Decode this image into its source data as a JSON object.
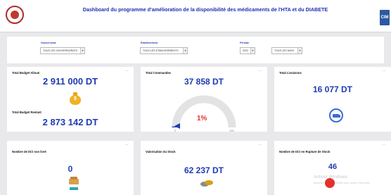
{
  "header": {
    "title": "Dashboard du programme d'amélioration de la disponibilité des médicaments de l'HTA et du DIABETE",
    "right_badge": "CIM"
  },
  "filters": {
    "governorate": {
      "label": "Gouvernorat",
      "value": "TOUS LES GOUVERNORATS"
    },
    "establishment": {
      "label": "Etablissement",
      "value": "TOUS LES ETABLISSEMENTS"
    },
    "period": {
      "label": "Période",
      "year": "2022",
      "month": "TOUS LES MOIS"
    }
  },
  "cards": {
    "budget": {
      "allocated_title": "Total Budget Alloué",
      "allocated_value": "2 911 000 DT",
      "remaining_title": "Total Budget Restant",
      "remaining_value": "2 873 142 DT"
    },
    "orders": {
      "title": "Total Commandes",
      "value": "37 858 DT",
      "gauge_percent_label": "1%",
      "gauge_min": "0",
      "gauge_max": "100",
      "gauge_fraction": 0.01
    },
    "deliveries": {
      "title": "Total Livraisons",
      "value": "16 077 DT"
    },
    "undelivered": {
      "title": "Nombre de DCI non livré",
      "value": "0"
    },
    "stock": {
      "title": "Valorisation du Stock",
      "value": "62 237 DT"
    },
    "rupture": {
      "title": "Nombre de DCI en Rupture de Stock",
      "value": "46"
    }
  },
  "watermark": {
    "line1": "Activer Windows",
    "line2": "Accédez aux paramètres pour activer Windows"
  },
  "colors": {
    "accent": "#1f3bb3",
    "gauge_track": "#e3e3e3",
    "gauge_marker": "#1f3bb3",
    "percent": "#e4312b"
  }
}
